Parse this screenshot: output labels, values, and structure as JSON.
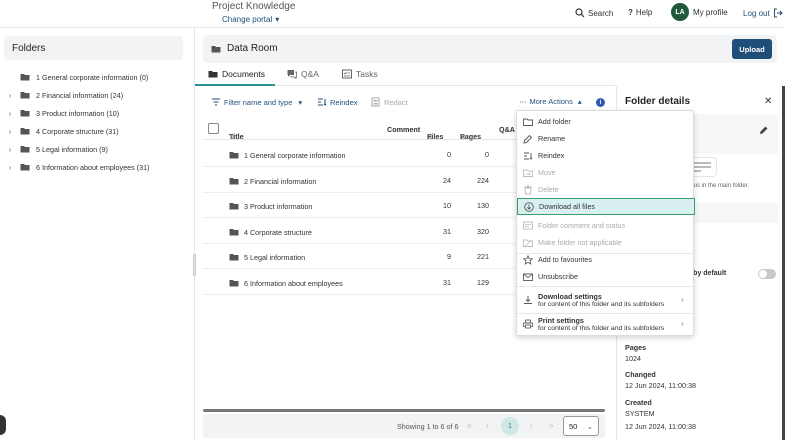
{
  "header": {
    "project": "Project Knowledge",
    "change_portal": "Change portal",
    "search": "Search",
    "help": "Help",
    "avatar": "LA",
    "my_profile": "My profile",
    "logout": "Log out"
  },
  "sidebar": {
    "title": "Folders",
    "items": [
      {
        "label": "1 General corporate information  (0)",
        "expandable": false
      },
      {
        "label": "2 Financial information  (24)",
        "expandable": true
      },
      {
        "label": "3 Product information  (10)",
        "expandable": true
      },
      {
        "label": "4 Corporate structure  (31)",
        "expandable": true
      },
      {
        "label": "5 Legal information  (9)",
        "expandable": true
      },
      {
        "label": "6 Information about employees  (31)",
        "expandable": true
      }
    ]
  },
  "main": {
    "title": "Data Room",
    "upload": "Upload",
    "tabs": [
      "Documents",
      "Q&A",
      "Tasks"
    ],
    "toolbar": {
      "filter": "Filter name and type",
      "reindex": "Reindex",
      "redact": "Redact",
      "more_actions": "More Actions"
    },
    "columns": {
      "title": "Title",
      "comment": "Comment",
      "files": "Files",
      "pages": "Pages",
      "qa": "Q&A"
    },
    "rows": [
      {
        "title": "1 General corporate information",
        "files": "0",
        "pages": "0"
      },
      {
        "title": "2 Financial information",
        "files": "24",
        "pages": "224"
      },
      {
        "title": "3 Product information",
        "files": "10",
        "pages": "130"
      },
      {
        "title": "4 Corporate structure",
        "files": "31",
        "pages": "320"
      },
      {
        "title": "5 Legal information",
        "files": "9",
        "pages": "221"
      },
      {
        "title": "6 Information about employees",
        "files": "31",
        "pages": "129"
      }
    ],
    "pager": {
      "info": "Showing 1 to 6 of 6",
      "current": "1",
      "page_size": "50"
    }
  },
  "menu": {
    "items": [
      {
        "label": "Add folder",
        "icon": "add-folder-icon",
        "disabled": false
      },
      {
        "label": "Rename",
        "icon": "pencil-icon",
        "disabled": false
      },
      {
        "label": "Reindex",
        "icon": "reindex-icon",
        "disabled": false
      },
      {
        "label": "Move",
        "icon": "move-icon",
        "disabled": true
      },
      {
        "label": "Delete",
        "icon": "trash-icon",
        "disabled": true
      },
      {
        "label": "Download all files",
        "icon": "download-icon",
        "disabled": false,
        "highlighted": true
      },
      {
        "label": "Folder comment and status",
        "icon": "comment-icon",
        "disabled": true
      },
      {
        "label": "Make folder not applicable",
        "icon": "not-applicable-icon",
        "disabled": true
      },
      {
        "label": "Add to favourites",
        "icon": "star-icon",
        "disabled": false
      },
      {
        "label": "Unsubscribe",
        "icon": "envelope-icon",
        "disabled": false
      }
    ],
    "download_settings": {
      "title": "Download settings",
      "sub": "for content of this folder and its subfolders"
    },
    "print_settings": {
      "title": "Print settings",
      "sub": "for content of this folder and its subfolders"
    }
  },
  "details": {
    "title": "Folder details",
    "status_note": "or status in the main folder.",
    "default_label": "ts by default",
    "pages_label": "Pages",
    "pages_value": "1024",
    "changed_label": "Changed",
    "changed_value": "12 Jun 2024, 11:00:38",
    "created_label": "Created",
    "created_by": "SYSTEM",
    "created_value": "12 Jun 2024, 11:00:38"
  },
  "colors": {
    "brand": "#1f4e79",
    "accent": "#2a8f8f",
    "avatar": "#1f5a3a",
    "highlight": "#d8f0f0"
  }
}
